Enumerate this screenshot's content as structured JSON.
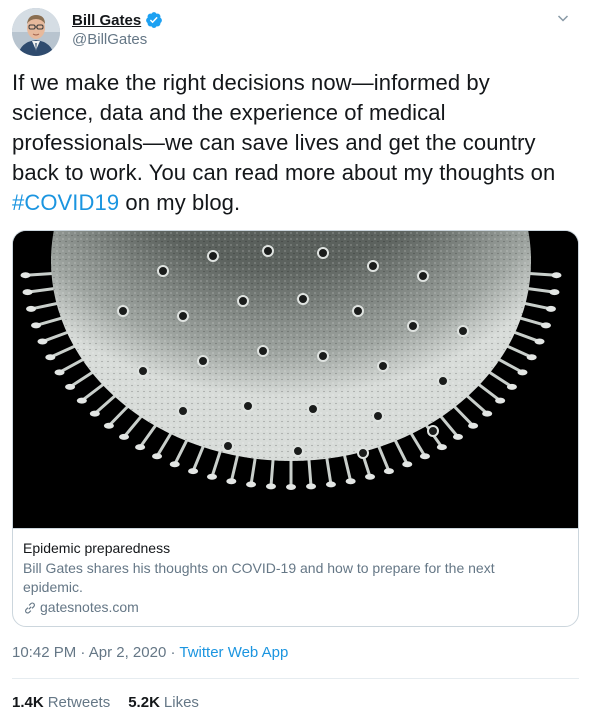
{
  "author": {
    "display_name": "Bill Gates",
    "handle": "@BillGates",
    "verified": true,
    "avatar_icon": "user-avatar-photo"
  },
  "tweet": {
    "text_line1": "If we make the right decisions now—informed by",
    "text_line2": "science, data and the experience of medical",
    "text_line3": "professionals—we can save lives and get the country",
    "text_line4": "back to work. You can read more about my thoughts on",
    "hashtag": "#COVID19",
    "text_tail": " on my blog."
  },
  "card": {
    "image_icon": "coronavirus-microscopy-image",
    "title": "Epidemic preparedness",
    "description": "Bill Gates shares his thoughts on COVID-19 and how to prepare for the next epidemic.",
    "url": "gatesnotes.com",
    "url_icon": "link-icon"
  },
  "meta": {
    "time": "10:42 PM",
    "separator1": " · ",
    "date": "Apr 2, 2020",
    "separator2": " · ",
    "source": "Twitter Web App"
  },
  "stats": {
    "retweets_count": "1.4K",
    "retweets_label": "Retweets",
    "likes_count": "5.2K",
    "likes_label": "Likes"
  },
  "colors": {
    "link": "#1b95e0",
    "verified": "#1da1f2",
    "secondary_text": "#657786",
    "border": "#ccd6dd"
  }
}
